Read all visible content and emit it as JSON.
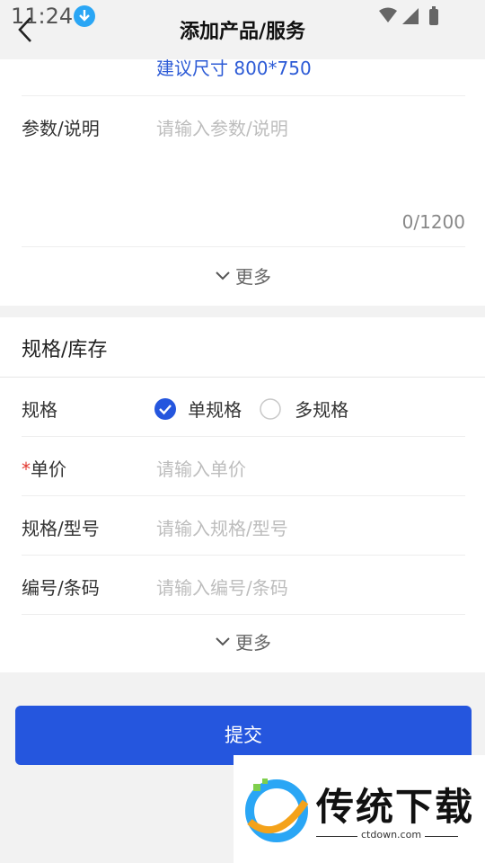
{
  "status": {
    "time": "11:24"
  },
  "header": {
    "title": "添加产品/服务"
  },
  "image_hint": "建议尺寸 800*750",
  "params": {
    "label": "参数/说明",
    "placeholder": "请输入参数/说明",
    "counter": "0/1200"
  },
  "more1": "更多",
  "spec_section": {
    "title": "规格/库存",
    "spec_label": "规格",
    "options": [
      "单规格",
      "多规格"
    ],
    "selected": "单规格"
  },
  "fields": [
    {
      "label": "单价",
      "required": true,
      "placeholder": "请输入单价"
    },
    {
      "label": "规格/型号",
      "placeholder": "请输入规格/型号"
    },
    {
      "label": "编号/条码",
      "placeholder": "请输入编号/条码"
    }
  ],
  "more2": "更多",
  "submit_label": "提交",
  "watermark": {
    "text": "传统下载",
    "url": "ctdown.com"
  },
  "colors": {
    "accent": "#2556de",
    "link": "#2d5bd6",
    "required": "#e2382f"
  }
}
